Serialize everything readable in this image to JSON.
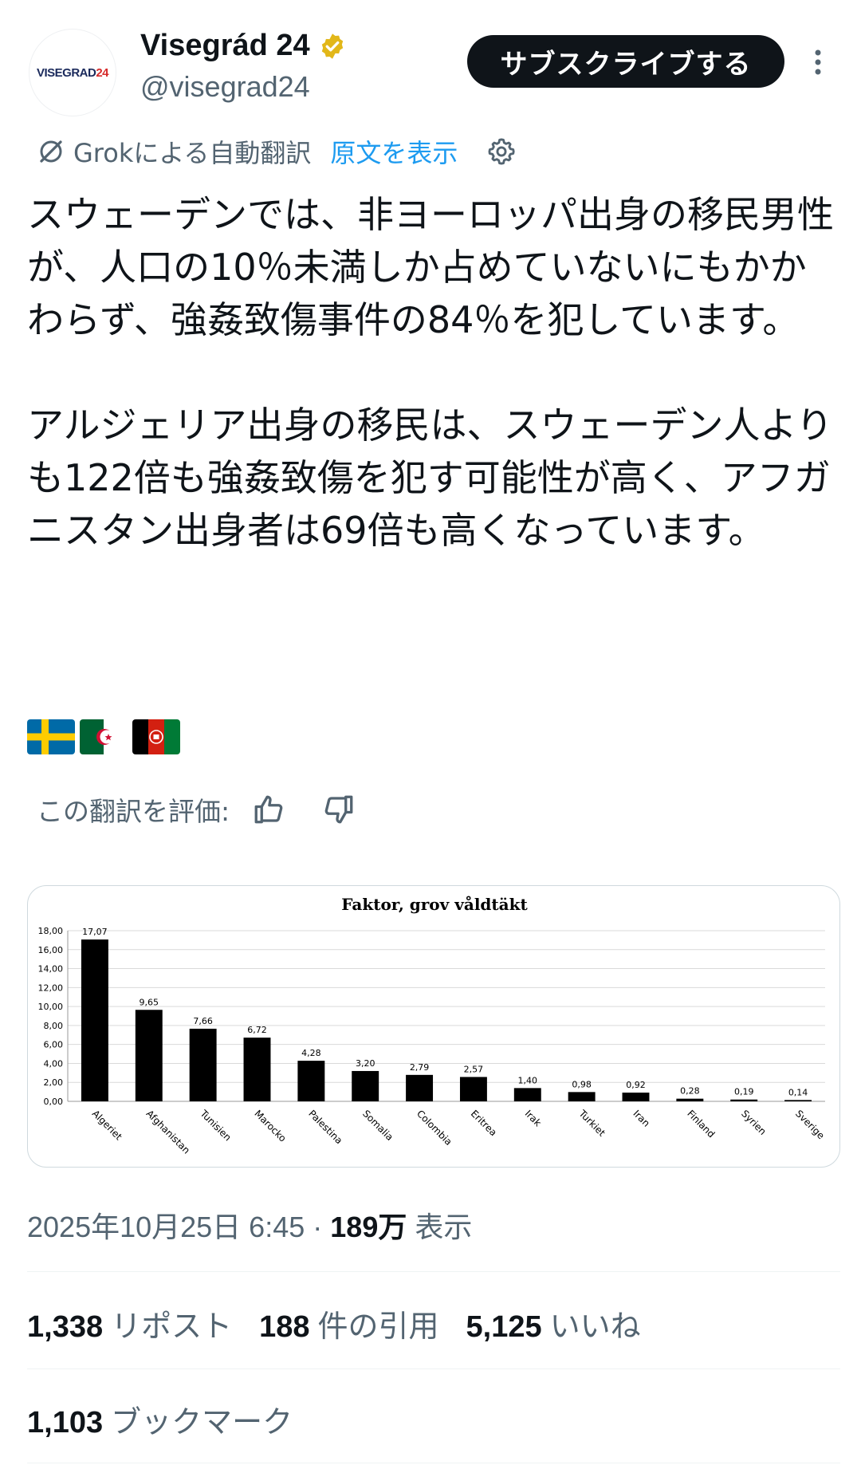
{
  "account": {
    "avatar_text_main": "VISEGRAD",
    "avatar_text_accent": "24",
    "display_name": "Visegrád 24",
    "handle": "@visegrad24",
    "subscribe_label": "サブスクライブする"
  },
  "translation": {
    "label": "Grokによる自動翻訳",
    "show_original": "原文を表示"
  },
  "tweet": {
    "text": "スウェーデンでは、非ヨーロッパ出身の移民男性が、人口の10％未満しか占めていないにもかかわらず、強姦致傷事件の84％を犯しています。\n\nアルジェリア出身の移民は、スウェーデン人よりも122倍も強姦致傷を犯す可能性が高く、アフガニスタン出身者は69倍も高くなっています。",
    "flags": [
      "sweden-flag",
      "algeria-flag",
      "afghanistan-flag"
    ]
  },
  "rating": {
    "label": "この翻訳を評価:"
  },
  "chart_data": {
    "type": "bar",
    "title": "Faktor, grov våldtäkt",
    "categories": [
      "Algeriet",
      "Afghanistan",
      "Tunisien",
      "Marocko",
      "Palestina",
      "Somalia",
      "Colombia",
      "Eritrea",
      "Irak",
      "Turkiet",
      "Iran",
      "Finland",
      "Syrien",
      "Sverige"
    ],
    "values": [
      17.07,
      9.65,
      7.66,
      6.72,
      4.28,
      3.2,
      2.79,
      2.57,
      1.4,
      0.98,
      0.92,
      0.28,
      0.19,
      0.14
    ],
    "value_labels": [
      "17,07",
      "9,65",
      "7,66",
      "6,72",
      "4,28",
      "3,20",
      "2,79",
      "2,57",
      "1,40",
      "0,98",
      "0,92",
      "0,28",
      "0,19",
      "0,14"
    ],
    "y_ticks": [
      "0,00",
      "2,00",
      "4,00",
      "6,00",
      "8,00",
      "10,00",
      "12,00",
      "14,00",
      "16,00",
      "18,00"
    ],
    "ylim": [
      0,
      18
    ],
    "bar_color": "#000000",
    "grid": true
  },
  "meta": {
    "timestamp": "2025年10月25日 6:45",
    "separator": "·",
    "views_count": "189万",
    "views_label": "表示"
  },
  "stats": {
    "reposts_count": "1,338",
    "reposts_label": "リポスト",
    "quotes_count": "188",
    "quotes_label": "件の引用",
    "likes_count": "5,125",
    "likes_label": "いいね",
    "bookmarks_count": "1,103",
    "bookmarks_label": "ブックマーク"
  }
}
